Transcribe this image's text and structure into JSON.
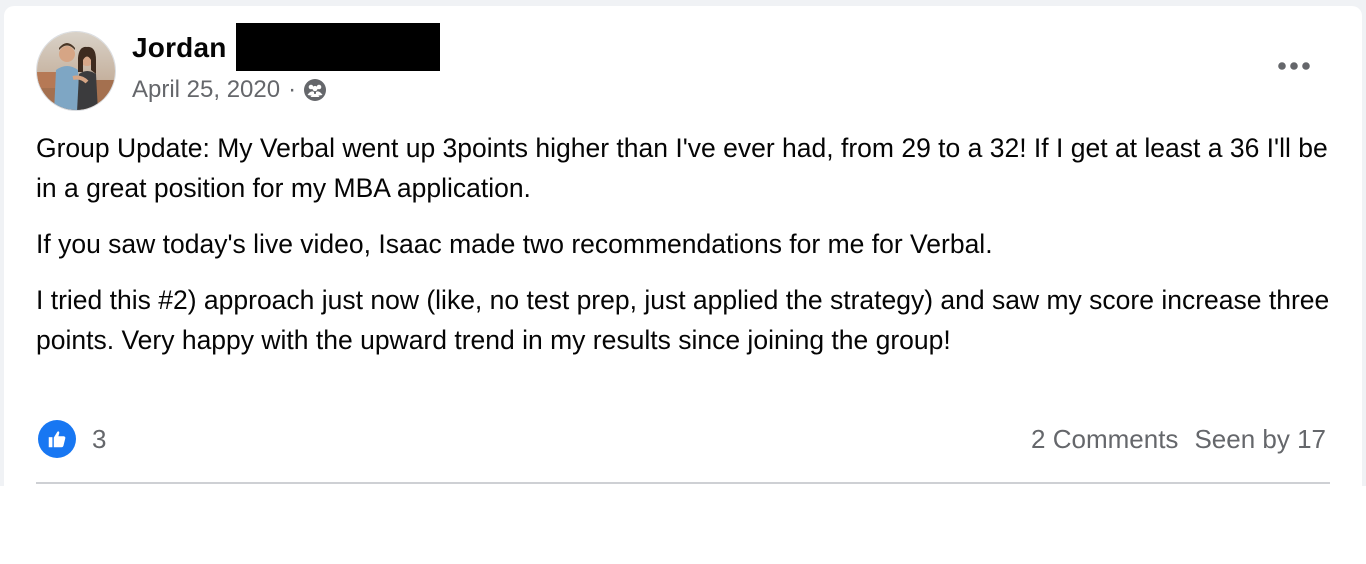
{
  "post": {
    "author_name": "Jordan",
    "date": "April 25, 2020",
    "separator": "·",
    "audience_icon": "group-members-icon",
    "more_icon": "more-horizontal-icon",
    "paragraphs": [
      "Group Update: My Verbal went up 3points higher than I've ever had, from 29 to a 32! If I get at least a 36 I'll be in a great position for my MBA application.",
      "If you saw today's live video, Isaac made two recommendations for me for Verbal.",
      "I tried this #2) approach just now (like, no test prep, just applied the strategy) and saw my score increase three points. Very happy with the upward trend in my results since joining the group!"
    ],
    "reactions": {
      "icon": "like-icon",
      "count": "3"
    },
    "comments": "2 Comments",
    "seen_by": "Seen by 17"
  },
  "colors": {
    "like_blue": "#1877f2",
    "secondary_text": "#65676b",
    "primary_text": "#050505",
    "divider": "#ced0d4"
  }
}
